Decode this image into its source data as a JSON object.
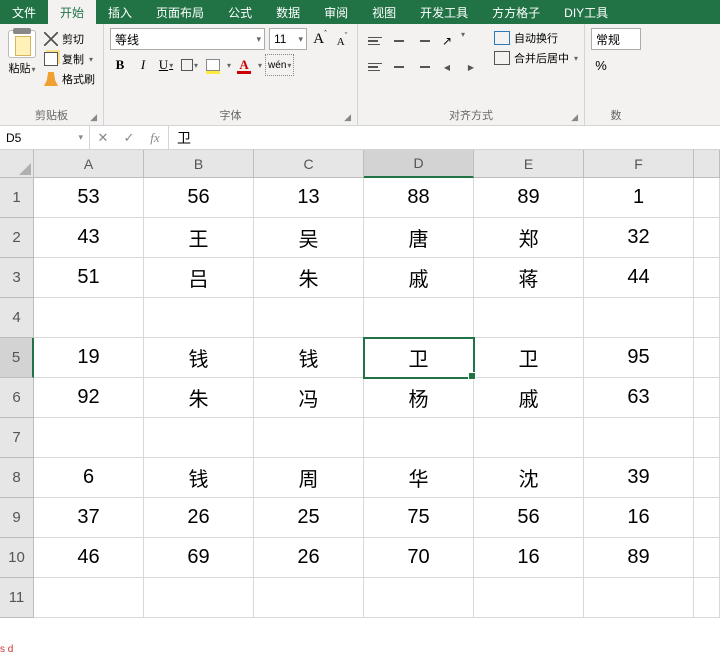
{
  "tabs": {
    "file": "文件",
    "home": "开始",
    "insert": "插入",
    "layout": "页面布局",
    "formulas": "公式",
    "data": "数据",
    "review": "审阅",
    "view": "视图",
    "dev": "开发工具",
    "ffgz": "方方格子",
    "diy": "DIY工具"
  },
  "clipboard": {
    "paste": "粘贴",
    "cut": "剪切",
    "copy": "复制",
    "format_painter": "格式刷",
    "group": "剪贴板"
  },
  "font": {
    "name": "等线",
    "size": "11",
    "group": "字体",
    "wen": "wén"
  },
  "alignment": {
    "wrap": "自动换行",
    "merge": "合并后居中",
    "group": "对齐方式"
  },
  "number": {
    "fmt": "常规",
    "group": "数",
    "pct": "%"
  },
  "namebox": "D5",
  "formula": "卫",
  "cols": [
    "A",
    "B",
    "C",
    "D",
    "E",
    "F"
  ],
  "rows": [
    "1",
    "2",
    "3",
    "4",
    "5",
    "6",
    "7",
    "8",
    "9",
    "10",
    "11"
  ],
  "cells": {
    "r1": [
      "53",
      "56",
      "13",
      "88",
      "89",
      "1"
    ],
    "r2": [
      "43",
      "王",
      "吴",
      "唐",
      "郑",
      "32"
    ],
    "r3": [
      "51",
      "吕",
      "朱",
      "戚",
      "蒋",
      "44"
    ],
    "r4": [
      "",
      "",
      "",
      "",
      "",
      ""
    ],
    "r5": [
      "19",
      "钱",
      "钱",
      "卫",
      "卫",
      "95"
    ],
    "r6": [
      "92",
      "朱",
      "冯",
      "杨",
      "戚",
      "63"
    ],
    "r7": [
      "",
      "",
      "",
      "",
      "",
      ""
    ],
    "r8": [
      "6",
      "钱",
      "周",
      "华",
      "沈",
      "39"
    ],
    "r9": [
      "37",
      "26",
      "25",
      "75",
      "56",
      "16"
    ],
    "r10": [
      "46",
      "69",
      "26",
      "70",
      "16",
      "89"
    ],
    "r11": [
      "",
      "",
      "",
      "",
      "",
      ""
    ]
  },
  "selected": {
    "col": "D",
    "row": "5"
  },
  "botmark": "s d",
  "chart_data": {
    "type": "table",
    "columns": [
      "A",
      "B",
      "C",
      "D",
      "E",
      "F"
    ],
    "rows": [
      [
        53,
        56,
        13,
        88,
        89,
        1
      ],
      [
        43,
        "王",
        "吴",
        "唐",
        "郑",
        32
      ],
      [
        51,
        "吕",
        "朱",
        "戚",
        "蒋",
        44
      ],
      [
        null,
        null,
        null,
        null,
        null,
        null
      ],
      [
        19,
        "钱",
        "钱",
        "卫",
        "卫",
        95
      ],
      [
        92,
        "朱",
        "冯",
        "杨",
        "戚",
        63
      ],
      [
        null,
        null,
        null,
        null,
        null,
        null
      ],
      [
        6,
        "钱",
        "周",
        "华",
        "沈",
        39
      ],
      [
        37,
        26,
        25,
        75,
        56,
        16
      ],
      [
        46,
        69,
        26,
        70,
        16,
        89
      ],
      [
        null,
        null,
        null,
        null,
        null,
        null
      ]
    ]
  }
}
